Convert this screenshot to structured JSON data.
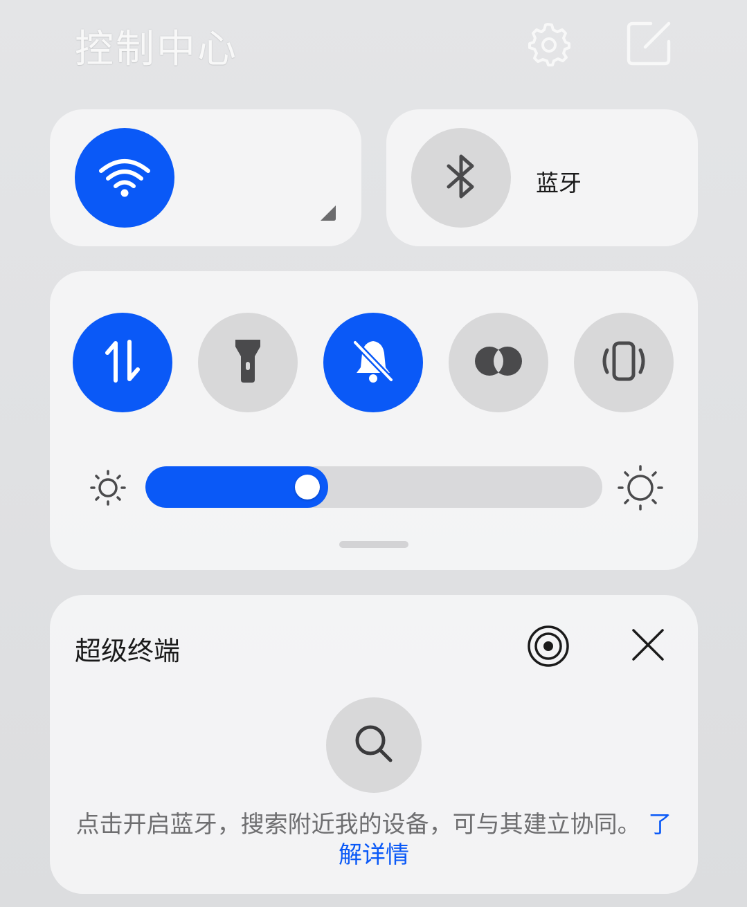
{
  "header": {
    "title": "控制中心",
    "settings_icon": "gear-icon",
    "edit_icon": "edit-icon"
  },
  "wifi": {
    "icon": "wifi-icon",
    "state": "on",
    "network_name": "",
    "signal_icon": "signal-corner-icon"
  },
  "bluetooth": {
    "icon": "bluetooth-icon",
    "state": "off",
    "label": "蓝牙"
  },
  "quick_toggles": [
    {
      "name": "mobile-data",
      "icon": "data-transfer-icon",
      "state": "on"
    },
    {
      "name": "flashlight",
      "icon": "flashlight-icon",
      "state": "off"
    },
    {
      "name": "mute",
      "icon": "bell-off-icon",
      "state": "on"
    },
    {
      "name": "eye-comfort",
      "icon": "overlapping-circles-icon",
      "state": "off"
    },
    {
      "name": "vibrate",
      "icon": "vibrate-phone-icon",
      "state": "off"
    }
  ],
  "brightness": {
    "level": 0.4,
    "min_icon": "sun-small-icon",
    "max_icon": "sun-large-icon"
  },
  "super_device": {
    "title": "超级终端",
    "radar_icon": "radar-icon",
    "close_icon": "close-icon",
    "search_icon": "search-icon",
    "description": "点击开启蓝牙，搜索附近我的设备，可与其建立协同。",
    "link_text": "了解详情"
  },
  "colors": {
    "accent": "#0a59f7",
    "tile_off": "#d8d8d9",
    "card_bg": "#f4f4f5"
  }
}
